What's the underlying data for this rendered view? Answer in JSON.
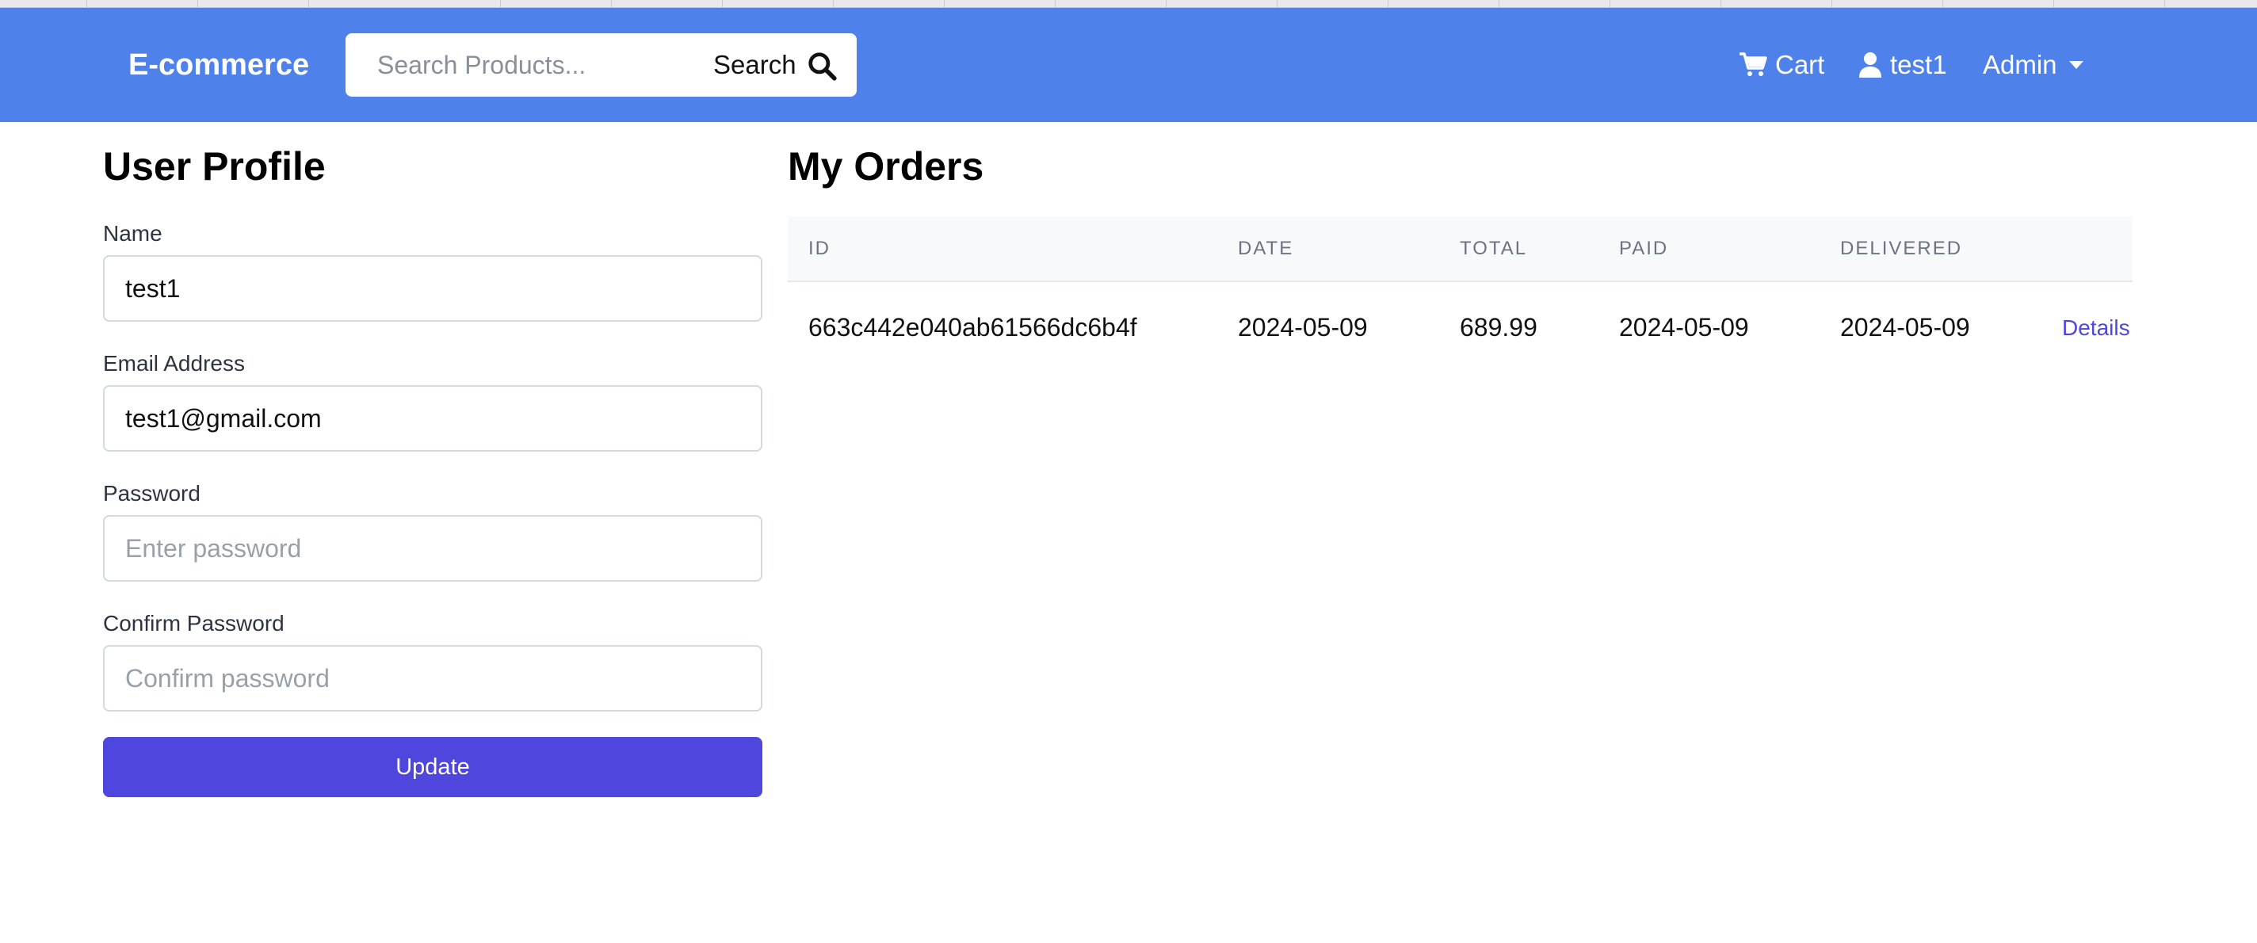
{
  "navbar": {
    "brand": "E-commerce",
    "search_placeholder": "Search Products...",
    "search_button": "Search",
    "cart_label": "Cart",
    "user_label": "test1",
    "admin_label": "Admin",
    "bg_color": "#4f81ea"
  },
  "profile": {
    "title": "User Profile",
    "name_label": "Name",
    "name_value": "test1",
    "email_label": "Email Address",
    "email_value": "test1@gmail.com",
    "password_label": "Password",
    "password_placeholder": "Enter password",
    "confirm_label": "Confirm Password",
    "confirm_placeholder": "Confirm password",
    "update_button": "Update",
    "button_color": "#4f46dd"
  },
  "orders": {
    "title": "My Orders",
    "columns": [
      "ID",
      "DATE",
      "TOTAL",
      "PAID",
      "DELIVERED",
      ""
    ],
    "rows": [
      {
        "id": "663c442e040ab61566dc6b4f",
        "date": "2024-05-09",
        "total": "689.99",
        "paid": "2024-05-09",
        "delivered": "2024-05-09",
        "action": "Details"
      }
    ]
  },
  "icons": {
    "search": "search-icon",
    "cart": "cart-icon",
    "user": "user-icon",
    "caret": "caret-down-icon"
  }
}
